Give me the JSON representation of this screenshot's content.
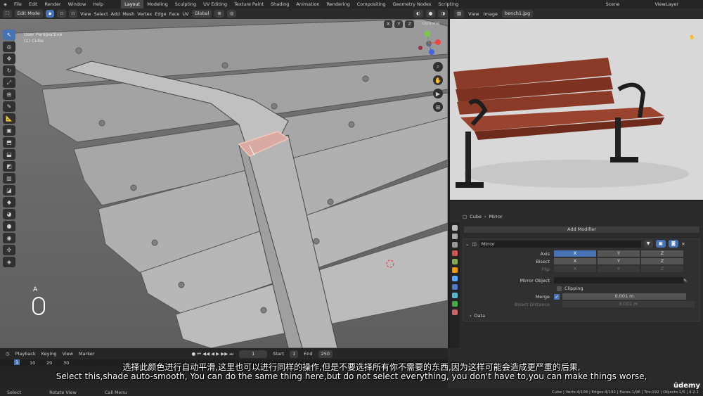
{
  "menu": {
    "file": "File",
    "edit": "Edit",
    "render": "Render",
    "window": "Window",
    "help": "Help"
  },
  "workspaces": [
    "Layout",
    "Modeling",
    "Sculpting",
    "UV Editing",
    "Texture Paint",
    "Shading",
    "Animation",
    "Rendering",
    "Compositing",
    "Geometry Nodes",
    "Scripting"
  ],
  "scene": {
    "scene": "Scene",
    "viewlayer": "ViewLayer"
  },
  "viewport": {
    "mode": "Edit Mode",
    "menus": [
      "View",
      "Select",
      "Add",
      "Mesh",
      "Vertex",
      "Edge",
      "Face",
      "UV"
    ],
    "orientation": "Global",
    "options": "Options",
    "perspective": "User Perspective",
    "object": "(1) Cube",
    "xyz": [
      "X",
      "Y",
      "Z"
    ],
    "key_hint": "A"
  },
  "image_editor": {
    "menus": [
      "View",
      "Image"
    ],
    "filename": "bench1.jpg"
  },
  "properties": {
    "object": "Cube",
    "modifier_tab": "Mirror",
    "add_modifier": "Add Modifier",
    "modifier_name": "Mirror",
    "axis_label": "Axis",
    "bisect_label": "Bisect",
    "flip_label": "Flip",
    "axis": [
      "X",
      "Y",
      "Z"
    ],
    "mirror_object_label": "Mirror Object",
    "clipping_label": "Clipping",
    "merge_label": "Merge",
    "merge_value": "0.001 m",
    "bisect_distance_label": "Bisect Distance",
    "bisect_distance_value": "0.001 m",
    "data_label": "Data"
  },
  "timeline": {
    "playback": "Playback",
    "keying": "Keying",
    "view": "View",
    "marker": "Marker",
    "frame": "1",
    "start_label": "Start",
    "start": "1",
    "end_label": "End",
    "end": "250",
    "ticks": [
      "1",
      "10",
      "20",
      "30"
    ]
  },
  "status": {
    "select": "Select",
    "rotate": "Rotate View",
    "call_menu": "Call Menu",
    "stats": "Cube | Verts:4/108 | Edges:4/192 | Faces:1/96 | Tris:192 | Objects:1/5 | 4.2.1"
  },
  "subtitles": {
    "cn": "选择此颜色进行自动平滑,这里也可以进行同样的操作,但是不要选择所有你不需要的东西,因为这样可能会造成更严重的后果,",
    "en": "Select this,shade auto-smooth, You can do the same thing here,but do not select everything, you don't have to,you can make things worse,"
  },
  "watermark": "ūdemy",
  "colors": {
    "accent": "#4772b3",
    "viewport_bg": "#6e6e6e",
    "bench_wood": "#8a3a26"
  }
}
